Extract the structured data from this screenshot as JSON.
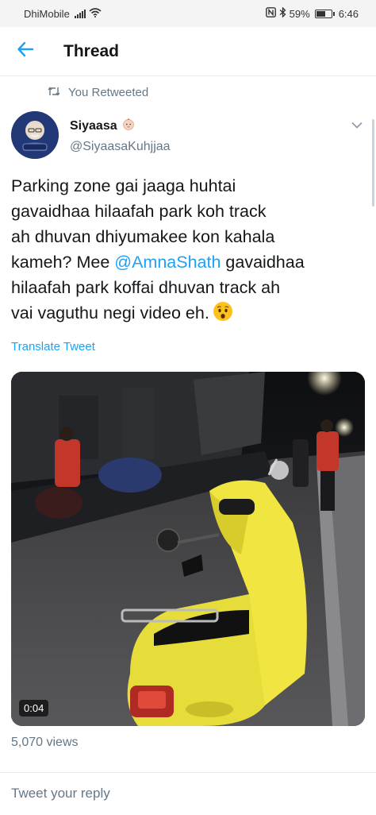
{
  "status_bar": {
    "carrier": "DhiMobile",
    "battery_text": "59%",
    "battery_level": 0.59,
    "time": "6:46",
    "icons": [
      "signal-icon",
      "wifi-icon",
      "nfc-icon",
      "bluetooth-icon",
      "battery-icon"
    ]
  },
  "header": {
    "title": "Thread",
    "back_icon": "arrow-left-icon"
  },
  "retweet": {
    "label": "You Retweeted",
    "icon": "retweet-icon"
  },
  "tweet": {
    "display_name": "Siyaasa",
    "handle": "@SiyaasaKuhjjaa",
    "text_lines": [
      "Parking zone gai jaaga huhtai",
      "gavaidhaa hilaafah park koh track",
      "ah dhuvan dhiyumakee kon kahala",
      "kameh? Mee ",
      "hilaafah park koffai dhuvan track ah",
      "vai vaguthu negi video eh."
    ],
    "mention": "@AmnaShath",
    "mention_suffix": " gavaidhaa",
    "translate_label": "Translate Tweet",
    "video_duration": "0:04",
    "views": "5,070 views"
  },
  "reply": {
    "placeholder": "Tweet your reply"
  },
  "colors": {
    "accent": "#1da1f2",
    "secondary_text": "#657786",
    "divider": "#e6ecf0"
  }
}
